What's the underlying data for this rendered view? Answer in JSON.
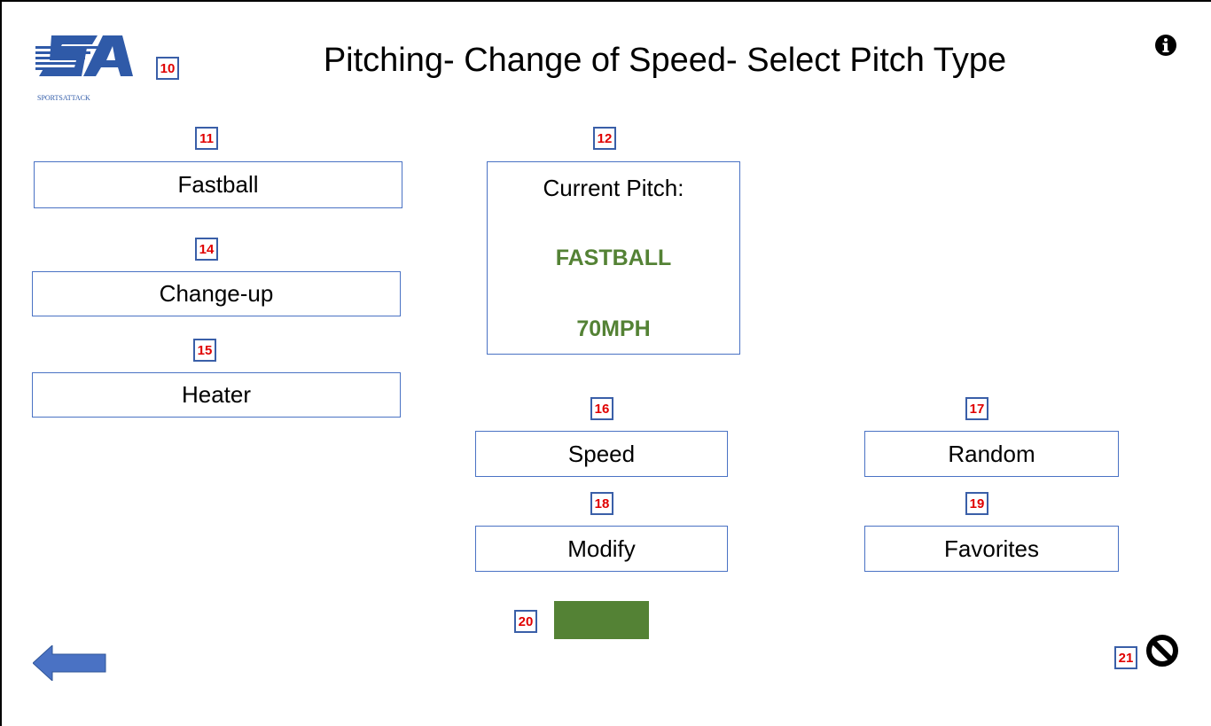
{
  "header": {
    "title": "Pitching- Change of Speed- Select Pitch Type",
    "logo_text": "SPORTSATTACK"
  },
  "badges": {
    "logo": "10",
    "fastball": "11",
    "current": "12",
    "changeup": "14",
    "heater": "15",
    "speed": "16",
    "random": "17",
    "modify": "18",
    "favorites": "19",
    "go": "20",
    "stop": "21"
  },
  "pitch_buttons": {
    "fastball": "Fastball",
    "changeup": "Change-up",
    "heater": "Heater"
  },
  "current_pitch": {
    "label": "Current Pitch:",
    "pitch": "FASTBALL",
    "speed": "70MPH"
  },
  "actions": {
    "speed": "Speed",
    "random": "Random",
    "modify": "Modify",
    "favorites": "Favorites"
  },
  "icons": {
    "info": "info-icon",
    "back": "back-arrow-icon",
    "stop": "no-entry-icon"
  },
  "colors": {
    "accent_green": "#548235",
    "button_border": "#4a72c4",
    "badge_text": "#e00000",
    "arrow_blue": "#4a72c4"
  }
}
